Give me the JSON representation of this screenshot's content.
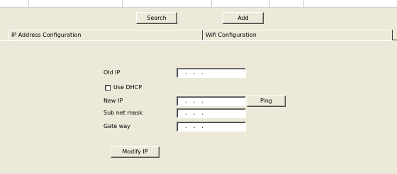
{
  "toolbar": {
    "search_label": "Search",
    "add_label": "Add"
  },
  "tabs": [
    {
      "label": "IP Address Configuration"
    },
    {
      "label": "Wifi Configuration"
    }
  ],
  "form": {
    "old_ip_label": "Old IP",
    "old_ip_value": ". . .",
    "dhcp_label": "Use DHCP",
    "dhcp_checked": false,
    "new_ip_label": "New IP",
    "new_ip_value": ". . .",
    "ping_label": "Ping",
    "subnet_label": "Sub net mask",
    "subnet_value": ". . .",
    "gateway_label": "Gate way",
    "gateway_value": ". . .",
    "modify_label": "Modify IP"
  }
}
